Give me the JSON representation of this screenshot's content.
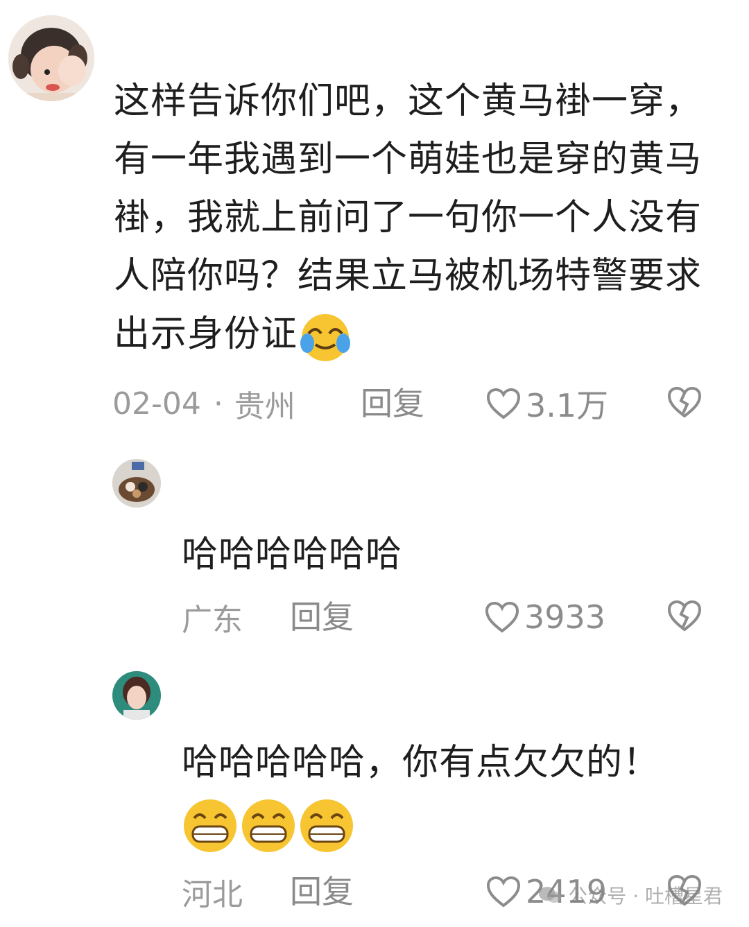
{
  "comments": [
    {
      "text": "这样告诉你们吧，这个黄马褂一穿，有一年我遇到一个萌娃也是穿的黄马褂，我就上前问了一句你一个人没有人陪你吗？结果立马被机场特警要求出示身份证",
      "emoji_after": "crying-laughing-emoji",
      "date": "02-04",
      "separator": "·",
      "location": "贵州",
      "reply_label": "回复",
      "likes": "3.1万"
    },
    {
      "text": "哈哈哈哈哈哈",
      "location": "广东",
      "reply_label": "回复",
      "likes": "3933"
    },
    {
      "text": "哈哈哈哈哈，你有点欠欠的！",
      "emoji_line": [
        "grinning-emoji",
        "grinning-emoji",
        "grinning-emoji"
      ],
      "location": "河北",
      "reply_label": "回复",
      "likes": "2419"
    }
  ],
  "watermark": {
    "label": "公众号 · 吐槽星君"
  },
  "colors": {
    "text": "#1e1e1e",
    "meta": "#9b9b9b",
    "emoji_yellow": "#f7c531"
  },
  "icons": {
    "like": "heart-outline-icon",
    "dislike": "broken-heart-icon"
  }
}
